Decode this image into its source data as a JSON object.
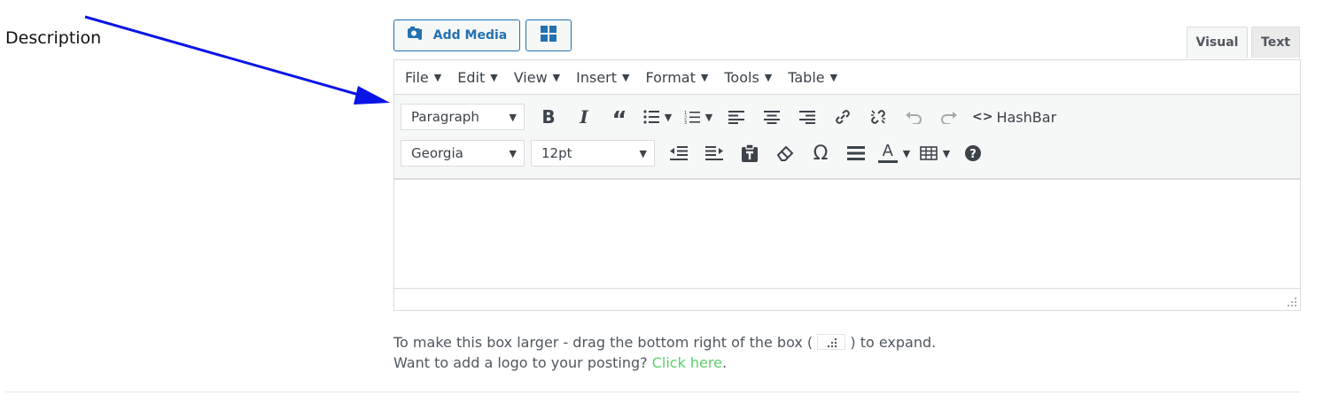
{
  "field": {
    "label": "Description"
  },
  "media": {
    "add_media_label": "Add Media",
    "add_media_icon": "camera-music-icon",
    "grid_icon": "grid-icon"
  },
  "mode_tabs": {
    "visual": "Visual",
    "text": "Text"
  },
  "menubar": {
    "items": [
      "File",
      "Edit",
      "View",
      "Insert",
      "Format",
      "Tools",
      "Table"
    ]
  },
  "toolbar": {
    "format_select": "Paragraph",
    "font_select": "Georgia",
    "size_select": "12pt",
    "hashbar_label": "HashBar",
    "row1_icons": [
      "bold-icon",
      "italic-icon",
      "blockquote-icon",
      "bullet-list-icon",
      "numbered-list-icon",
      "align-left-icon",
      "align-center-icon",
      "align-right-icon",
      "link-icon",
      "unlink-icon",
      "undo-icon",
      "redo-icon",
      "code-icon"
    ],
    "row2_icons": [
      "outdent-icon",
      "indent-icon",
      "paste-text-icon",
      "clear-format-icon",
      "omega-icon",
      "horizontal-rule-icon",
      "text-color-icon",
      "table-icon",
      "help-icon"
    ]
  },
  "help": {
    "line1_before": "To make this box larger - drag the bottom right of the box (",
    "line1_after": ") to expand.",
    "line2_text": "Want to add a logo to your posting?",
    "line2_link": "Click here",
    "line2_end": "."
  },
  "colors": {
    "accent": "#2271b1",
    "link": "#5ccf6b",
    "arrow": "#0a14e6"
  }
}
